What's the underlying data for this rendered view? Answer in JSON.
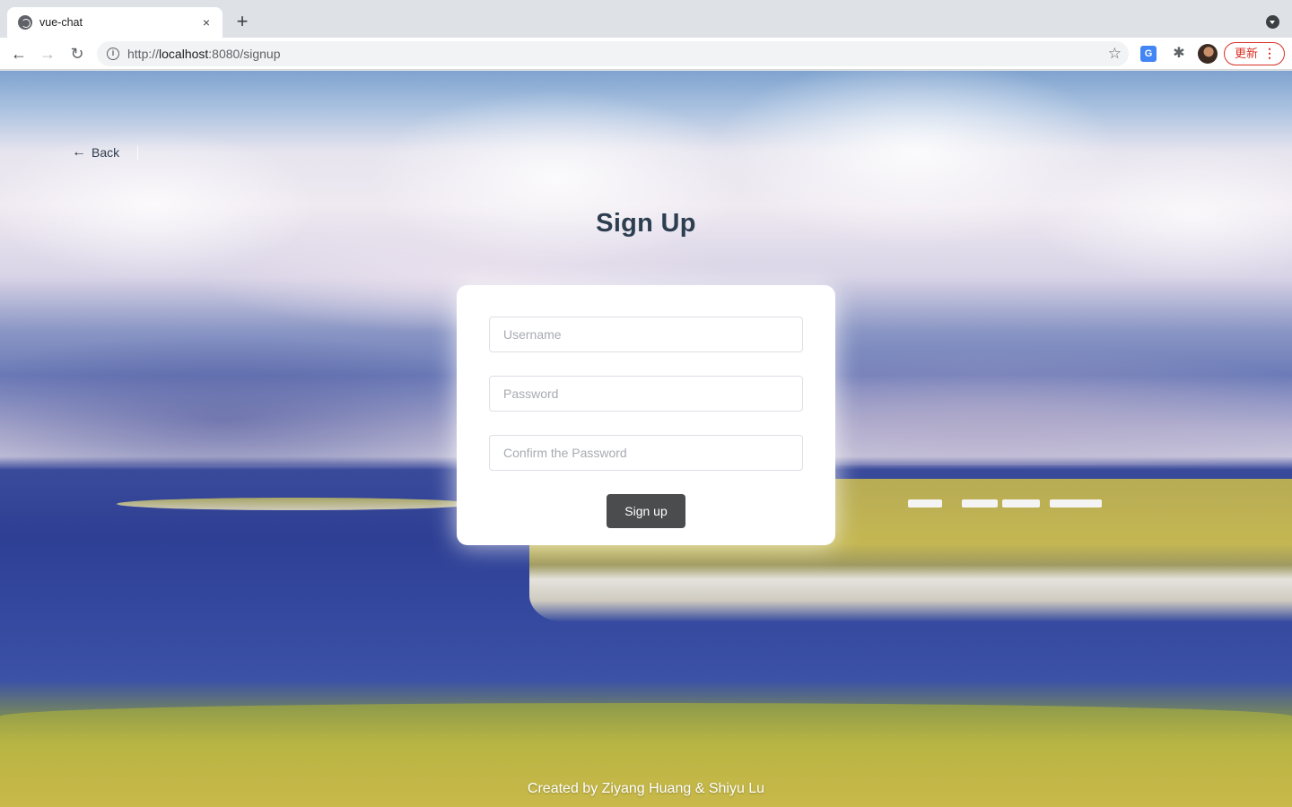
{
  "browser": {
    "tab_title": "vue-chat",
    "tab_close": "×",
    "new_tab": "+",
    "url_scheme": "http://",
    "url_host": "localhost",
    "url_path": ":8080/signup",
    "update_label": "更新",
    "update_menu": "⋮",
    "back_glyph": "←",
    "forward_glyph": "→",
    "reload_glyph": "↻",
    "info_glyph": "i",
    "star_glyph": "☆",
    "translate_glyph": "G",
    "extensions_glyph": "✱"
  },
  "page": {
    "back_label": "Back",
    "back_arrow": "←",
    "title": "Sign Up",
    "form": {
      "username_placeholder": "Username",
      "password_placeholder": "Password",
      "confirm_placeholder": "Confirm the Password",
      "submit_label": "Sign up"
    },
    "footer": "Created by Ziyang Huang & Shiyu Lu"
  },
  "colors": {
    "title": "#2c3e50",
    "button_bg": "#4a4c4e",
    "update_red": "#d93025"
  }
}
